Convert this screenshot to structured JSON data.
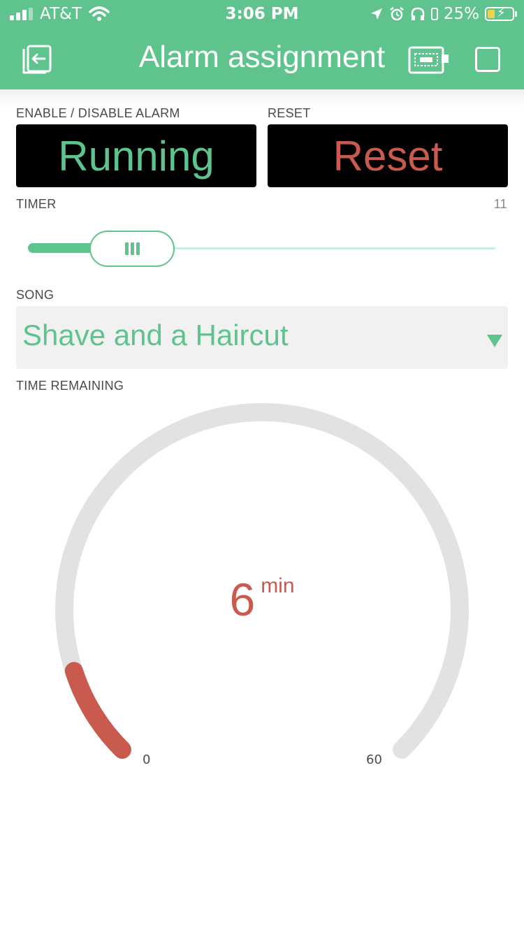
{
  "status_bar": {
    "carrier": "AT&T",
    "time": "3:06 PM",
    "battery": "25%",
    "icons": [
      "signal-bars-icon",
      "wifi-icon",
      "location-arrow-icon",
      "alarm-clock-icon",
      "headphones-icon",
      "battery-charging-icon"
    ]
  },
  "nav": {
    "title": "Alarm assignment",
    "back_icon": "exit-back-icon",
    "device_icon": "device-board-icon",
    "square_icon": "stop-square-icon"
  },
  "alarm": {
    "enable_label": "ENABLE / DISABLE ALARM",
    "enable_button": "Running",
    "reset_label": "RESET",
    "reset_button": "Reset"
  },
  "timer": {
    "label": "TIMER",
    "value": "11",
    "slider_fraction": 0.18
  },
  "song": {
    "label": "SONG",
    "selected": "Shave and a Haircut"
  },
  "time_remaining": {
    "label": "TIME REMAINING",
    "value": "6",
    "unit": "min",
    "min": "0",
    "max": "60",
    "gauge_value": 6
  },
  "colors": {
    "accent": "#5fc38e",
    "danger": "#c85a4e",
    "gauge_track": "#e1e2e4",
    "button_bg": "#000000"
  }
}
